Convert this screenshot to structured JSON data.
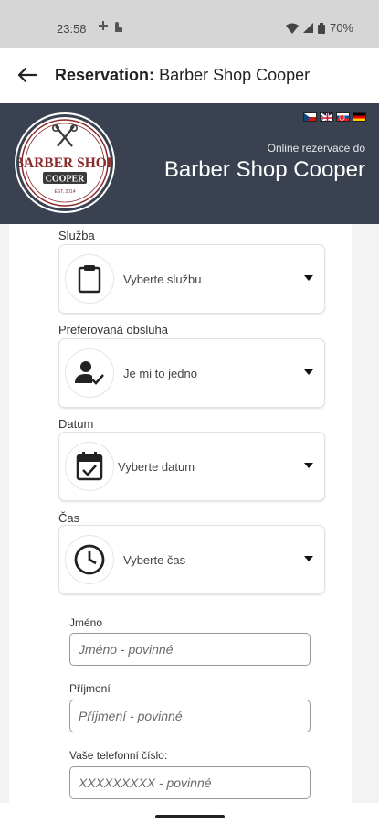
{
  "status_bar": {
    "time": "23:58",
    "battery": "70%"
  },
  "app_bar": {
    "title_prefix": "Reservation:",
    "title_shop": "Barber Shop Cooper"
  },
  "hero": {
    "logo_text": {
      "line1": "BARBER SHOP",
      "line2": "COOPER",
      "line3": "EST. 2014"
    },
    "subtitle": "Online rezervace do",
    "shop_name": "Barber Shop Cooper",
    "flags": [
      "cz-flag",
      "uk-flag",
      "sk-flag",
      "de-flag"
    ]
  },
  "form": {
    "service": {
      "label": "Služba",
      "value": "Vyberte službu",
      "icon": "clipboard-icon"
    },
    "staff": {
      "label": "Preferovaná obsluha",
      "value": "Je mi to jedno",
      "icon": "person-check-icon"
    },
    "date": {
      "label": "Datum",
      "value": "Vyberte datum",
      "icon": "calendar-check-icon"
    },
    "time": {
      "label": "Čas",
      "value": "Vyberte čas",
      "icon": "clock-icon"
    },
    "first_name": {
      "label": "Jméno",
      "placeholder": "Jméno - povinné"
    },
    "last_name": {
      "label": "Příjmení",
      "placeholder": "Příjmení - povinné"
    },
    "phone": {
      "label": "Vaše telefonní číslo:",
      "placeholder": "XXXXXXXXX - povinné"
    }
  },
  "colors": {
    "hero_bg": "#3a4150",
    "logo_red": "#8b2b2b"
  }
}
